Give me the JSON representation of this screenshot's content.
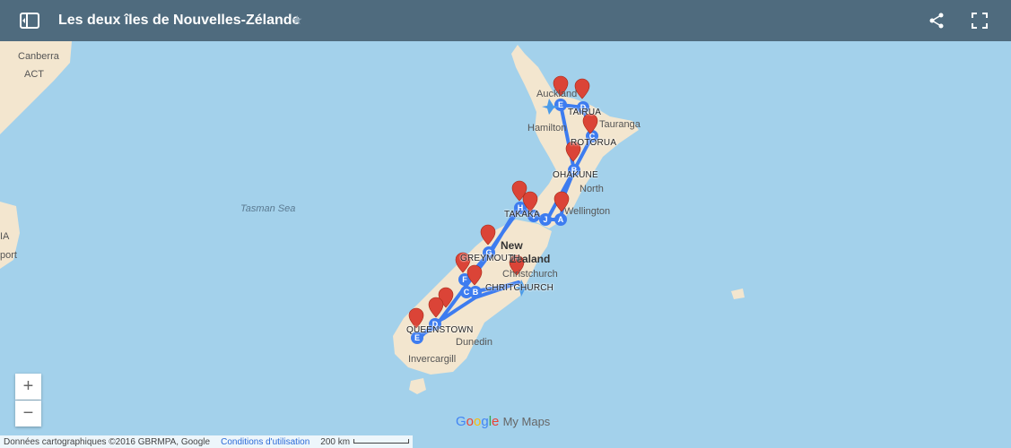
{
  "header": {
    "title": "Les deux îles de Nouvelles-Zélande",
    "star": "★"
  },
  "map": {
    "labels": {
      "canberra": "Canberra",
      "act": "ACT",
      "tasman_sea": "Tasman Sea",
      "auckland": "Auckland",
      "hamilton": "Hamilton",
      "tauranga": "Tauranga",
      "wellington": "Wellington",
      "new_zealand_1": "New",
      "new_zealand_2": "Zealand",
      "christchurch": "Christchurch",
      "dunedin": "Dunedin",
      "invercargill": "Invercargill",
      "north": "North",
      "edge_ia": "IA",
      "edge_port": "port"
    },
    "stops": {
      "tairua": "TAIRUA",
      "rotorua": "ROTORUA",
      "ohakune": "OHAKUNE",
      "takaka": "TAKAKA",
      "greymouth": "GREYMOUTH",
      "chritchurch": "CHRITCHURCH",
      "queenstown": "QUEENSTOWN"
    },
    "waypoint_letters": [
      "E",
      "D",
      "C",
      "B",
      "A",
      "J",
      "I",
      "H",
      "G",
      "F",
      "C",
      "B",
      "D",
      "E"
    ],
    "route_color": "#3d7cf0",
    "marker_color": "#db4437"
  },
  "controls": {
    "zoom_in": "+",
    "zoom_out": "−"
  },
  "footer": {
    "attribution": "Données cartographiques ©2016 GBRMPA, Google",
    "terms": "Conditions d'utilisation",
    "scale": "200 km"
  },
  "branding": {
    "google": [
      "G",
      "o",
      "o",
      "g",
      "l",
      "e"
    ],
    "product": "My Maps"
  }
}
